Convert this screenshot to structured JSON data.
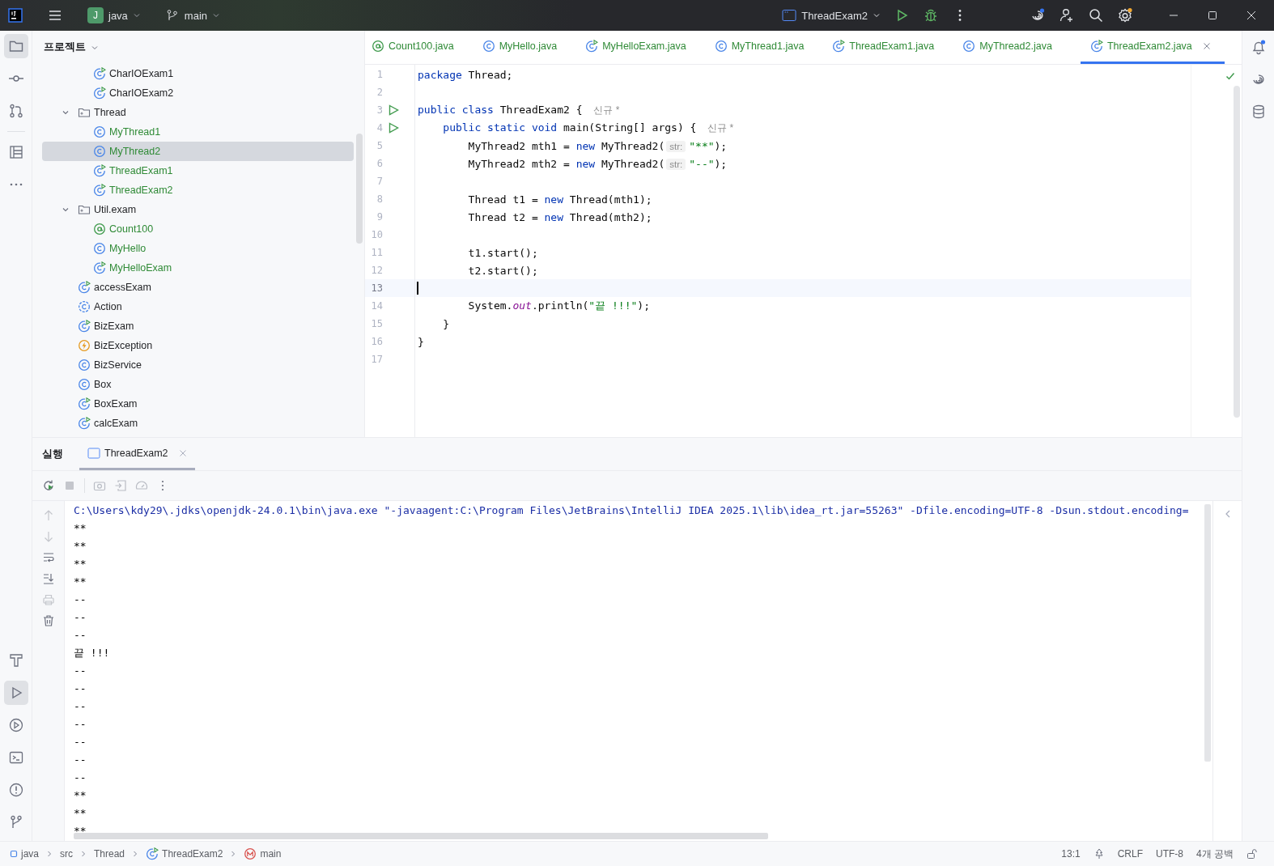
{
  "title_bar": {
    "project": {
      "badge": "J",
      "name": "java"
    },
    "branch": "main",
    "run_config": "ThreadExam2"
  },
  "project_panel": {
    "title": "프로젝트",
    "tree": [
      {
        "kind": "continued",
        "children": [
          {
            "label": "CharIOExam1",
            "kind": "runnable",
            "new": false,
            "selected": false
          },
          {
            "label": "CharIOExam2",
            "kind": "runnable",
            "new": false,
            "selected": false
          }
        ]
      },
      {
        "label": "Thread",
        "kind": "folder",
        "expanded": true,
        "selected": false,
        "children": [
          {
            "label": "MyThread1",
            "kind": "class",
            "new": true,
            "selected": false
          },
          {
            "label": "MyThread2",
            "kind": "class",
            "new": true,
            "selected": true
          },
          {
            "label": "ThreadExam1",
            "kind": "runnable",
            "new": true,
            "selected": false
          },
          {
            "label": "ThreadExam2",
            "kind": "runnable",
            "new": true,
            "selected": false
          }
        ]
      },
      {
        "label": "Util.exam",
        "kind": "folder",
        "expanded": true,
        "selected": false,
        "children": [
          {
            "label": "Count100",
            "kind": "annotation",
            "new": true,
            "selected": false
          },
          {
            "label": "MyHello",
            "kind": "class",
            "new": true,
            "selected": false
          },
          {
            "label": "MyHelloExam",
            "kind": "runnable",
            "new": true,
            "selected": false
          }
        ]
      },
      {
        "label": "accessExam",
        "kind": "runnable",
        "new": false,
        "selected": false
      },
      {
        "label": "Action",
        "kind": "abstract",
        "new": false,
        "selected": false
      },
      {
        "label": "BizExam",
        "kind": "runnable",
        "new": false,
        "selected": false
      },
      {
        "label": "BizException",
        "kind": "exception",
        "new": false,
        "selected": false
      },
      {
        "label": "BizService",
        "kind": "class",
        "new": false,
        "selected": false
      },
      {
        "label": "Box",
        "kind": "class",
        "new": false,
        "selected": false
      },
      {
        "label": "BoxExam",
        "kind": "runnable",
        "new": false,
        "selected": false
      },
      {
        "label": "calcExam",
        "kind": "runnable",
        "new": false,
        "selected": false
      }
    ]
  },
  "editor_tabs": [
    {
      "label": "Count100.java",
      "kind": "annotation",
      "selected": false
    },
    {
      "label": "MyHello.java",
      "kind": "class",
      "selected": false
    },
    {
      "label": "MyHelloExam.java",
      "kind": "runnable",
      "selected": false
    },
    {
      "label": "MyThread1.java",
      "kind": "class",
      "selected": false
    },
    {
      "label": "ThreadExam1.java",
      "kind": "runnable",
      "selected": false
    },
    {
      "label": "MyThread2.java",
      "kind": "class",
      "selected": false
    },
    {
      "label": "ThreadExam2.java",
      "kind": "runnable",
      "selected": true
    }
  ],
  "editor": {
    "lines": [
      {
        "number": "1",
        "run": false,
        "current": false,
        "tokens": [
          {
            "kind": "keyword",
            "text": "package"
          },
          {
            "kind": "plain",
            "text": " Thread;"
          }
        ]
      },
      {
        "number": "2",
        "run": false,
        "current": false
      },
      {
        "number": "3",
        "run": true,
        "current": false,
        "tokens": [
          {
            "kind": "keyword",
            "text": "public class"
          },
          {
            "kind": "plain",
            "text": " ThreadExam2 { "
          },
          {
            "kind": "author",
            "text": "신규 *"
          }
        ]
      },
      {
        "number": "4",
        "run": true,
        "current": false,
        "tokens": [
          {
            "kind": "keyword",
            "text": "    public static void"
          },
          {
            "kind": "plain",
            "text": " main(String[] args) { "
          },
          {
            "kind": "author",
            "text": "신규 *"
          }
        ]
      },
      {
        "number": "5",
        "run": false,
        "current": false,
        "tokens": [
          {
            "kind": "plain",
            "text": "        MyThread2 mth1 = "
          },
          {
            "kind": "keyword",
            "text": "new"
          },
          {
            "kind": "plain",
            "text": " MyThread2("
          },
          {
            "kind": "param",
            "text": "str:"
          },
          {
            "kind": "string",
            "text": "\"**\""
          },
          {
            "kind": "plain",
            "text": ");"
          }
        ]
      },
      {
        "number": "6",
        "run": false,
        "current": false,
        "tokens": [
          {
            "kind": "plain",
            "text": "        MyThread2 mth2 = "
          },
          {
            "kind": "keyword",
            "text": "new"
          },
          {
            "kind": "plain",
            "text": " MyThread2("
          },
          {
            "kind": "param",
            "text": "str:"
          },
          {
            "kind": "string",
            "text": "\"--\""
          },
          {
            "kind": "plain",
            "text": ");"
          }
        ]
      },
      {
        "number": "7",
        "run": false,
        "current": false
      },
      {
        "number": "8",
        "run": false,
        "current": false,
        "tokens": [
          {
            "kind": "plain",
            "text": "        Thread t1 = "
          },
          {
            "kind": "keyword",
            "text": "new"
          },
          {
            "kind": "plain",
            "text": " Thread(mth1);"
          }
        ]
      },
      {
        "number": "9",
        "run": false,
        "current": false,
        "tokens": [
          {
            "kind": "plain",
            "text": "        Thread t2 = "
          },
          {
            "kind": "keyword",
            "text": "new"
          },
          {
            "kind": "plain",
            "text": " Thread(mth2);"
          }
        ]
      },
      {
        "number": "10",
        "run": false,
        "current": false
      },
      {
        "number": "11",
        "run": false,
        "current": false,
        "tokens": [
          {
            "kind": "plain",
            "text": "        t1.start();"
          }
        ]
      },
      {
        "number": "12",
        "run": false,
        "current": false,
        "tokens": [
          {
            "kind": "plain",
            "text": "        t2.start();"
          }
        ]
      },
      {
        "number": "13",
        "run": false,
        "current": true
      },
      {
        "number": "14",
        "run": false,
        "current": false,
        "tokens": [
          {
            "kind": "plain",
            "text": "        System."
          },
          {
            "kind": "field",
            "text": "out"
          },
          {
            "kind": "plain",
            "text": ".println("
          },
          {
            "kind": "string",
            "text": "\"끝 !!!\""
          },
          {
            "kind": "plain",
            "text": ");"
          }
        ]
      },
      {
        "number": "15",
        "run": false,
        "current": false,
        "tokens": [
          {
            "kind": "plain",
            "text": "    }"
          }
        ]
      },
      {
        "number": "16",
        "run": false,
        "current": false,
        "tokens": [
          {
            "kind": "plain",
            "text": "}"
          }
        ]
      },
      {
        "number": "17",
        "run": false,
        "current": false
      }
    ]
  },
  "run_panel": {
    "title": "실행",
    "tabs": [
      {
        "label": "ThreadExam2",
        "selected": true
      }
    ],
    "console": [
      {
        "kind": "command",
        "text": "C:\\Users\\kdy29\\.jdks\\openjdk-24.0.1\\bin\\java.exe \"-javaagent:C:\\Program Files\\JetBrains\\IntelliJ IDEA 2025.1\\lib\\idea_rt.jar=55263\" -Dfile.encoding=UTF-8 -Dsun.stdout.encoding="
      },
      {
        "kind": "output",
        "text": "**"
      },
      {
        "kind": "output",
        "text": "**"
      },
      {
        "kind": "output",
        "text": "**"
      },
      {
        "kind": "output",
        "text": "**"
      },
      {
        "kind": "output",
        "text": "--"
      },
      {
        "kind": "output",
        "text": "--"
      },
      {
        "kind": "output",
        "text": "--"
      },
      {
        "kind": "output",
        "text": "끝 !!!"
      },
      {
        "kind": "output",
        "text": "--"
      },
      {
        "kind": "output",
        "text": "--"
      },
      {
        "kind": "output",
        "text": "--"
      },
      {
        "kind": "output",
        "text": "--"
      },
      {
        "kind": "output",
        "text": "--"
      },
      {
        "kind": "output",
        "text": "--"
      },
      {
        "kind": "output",
        "text": "--"
      },
      {
        "kind": "output",
        "text": "**"
      },
      {
        "kind": "output",
        "text": "**"
      },
      {
        "kind": "output",
        "text": "**"
      }
    ]
  },
  "status_bar": {
    "breadcrumbs": [
      {
        "label": "java",
        "kind": "module"
      },
      {
        "label": "src",
        "kind": "none"
      },
      {
        "label": "Thread",
        "kind": "none"
      },
      {
        "label": "ThreadExam2",
        "kind": "runnable"
      },
      {
        "label": "main",
        "kind": "method"
      }
    ],
    "position": "13:1",
    "line_separator": "CRLF",
    "encoding": "UTF-8",
    "indent": "4개 공백"
  }
}
